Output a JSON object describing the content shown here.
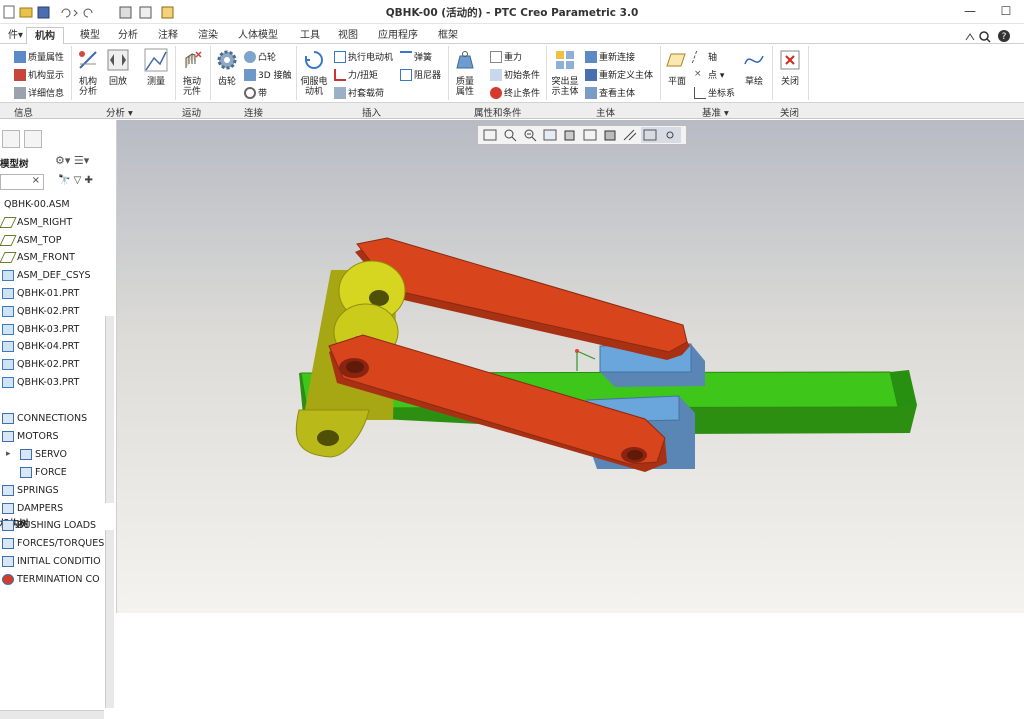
{
  "window": {
    "title": "QBHK-00 (活动的) - PTC Creo Parametric 3.0"
  },
  "menu_tabs": [
    "件▾",
    "机构",
    "模型",
    "分析",
    "注释",
    "渲染",
    "人体模型",
    "工具",
    "视图",
    "应用程序",
    "框架"
  ],
  "active_tab": "机构",
  "ribbon": {
    "info": {
      "items": [
        "质量属性",
        "机构显示",
        "详细信息"
      ],
      "group": "信息"
    },
    "analysis": {
      "mech_analysis": "机构分析",
      "playback": "回放",
      "measure": "测量",
      "group": "分析 ▾"
    },
    "motion": {
      "drag": "拖动元件",
      "group": "运动"
    },
    "connect": {
      "gear": "齿轮",
      "cam": "凸轮",
      "slot_3d": "3D 接触",
      "belt": "带",
      "group": "连接"
    },
    "insert": {
      "servo": "伺服电动机",
      "exec_motor": "执行电动机",
      "force": "力/扭矩",
      "bushing": "衬套载荷",
      "spring": "弹簧",
      "damper": "阻尼器",
      "group": "插入"
    },
    "props": {
      "mass": "质量属性",
      "gravity": "重力",
      "init": "初始条件",
      "term": "终止条件",
      "group": "属性和条件"
    },
    "body": {
      "highlight": "突出显示主体",
      "reconnect": "重新连接",
      "redefine": "重新定义主体",
      "view_body": "查看主体",
      "group": "主体"
    },
    "datum": {
      "plane": "平面",
      "axis": "轴",
      "point": "点 ▾",
      "csys": "坐标系",
      "sketch": "草绘",
      "group": "基准 ▾"
    },
    "close": {
      "label": "关闭",
      "group": "关闭"
    }
  },
  "model_tree": {
    "header": "模型树",
    "search_placeholder": "",
    "items": [
      "QBHK-00.ASM",
      "ASM_RIGHT",
      "ASM_TOP",
      "ASM_FRONT",
      "ASM_DEF_CSYS",
      "QBHK-01.PRT",
      "QBHK-02.PRT",
      "QBHK-03.PRT",
      "QBHK-04.PRT",
      "QBHK-02.PRT",
      "QBHK-03.PRT"
    ]
  },
  "mech_tree": {
    "header": "机构树",
    "items": [
      "CONNECTIONS",
      "MOTORS",
      "SERVO",
      "FORCE",
      "SPRINGS",
      "DAMPERS",
      "BUSHING LOADS",
      "FORCES/TORQUES",
      "INITIAL CONDITIO",
      "TERMINATION CO"
    ]
  },
  "colors": {
    "red_link": "#d8441c",
    "yellow": "#d6d620",
    "green": "#3fc61a",
    "blue": "#6a9fd0",
    "bg_top": "#b8bbc4",
    "bg_bottom": "#f4f3ef"
  }
}
